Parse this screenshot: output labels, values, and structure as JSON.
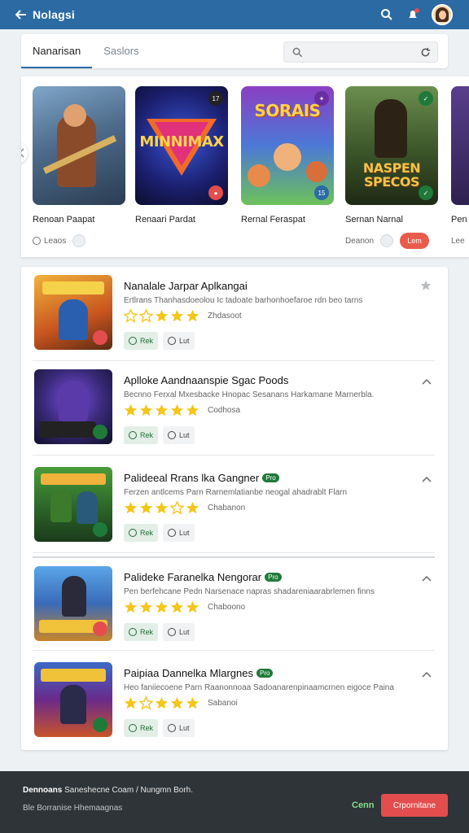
{
  "appbar": {
    "title": "Nolagsi"
  },
  "tabs": {
    "active": "Nanarisan",
    "inactive": "Saslors"
  },
  "carousel": [
    {
      "name": "Renoan Paapat",
      "meta": "Leaos",
      "cta": ""
    },
    {
      "name": "Renaari Pardat",
      "thumb_text": "MINNIMAX",
      "meta": "",
      "cta": ""
    },
    {
      "name": "Rernal Feraspat",
      "thumb_text": "SORAIS",
      "meta": "",
      "cta": ""
    },
    {
      "name": "Sernan Narnal",
      "thumb_text": "NASPEN SPECOS",
      "meta": "Deanon",
      "cta": "Lem"
    },
    {
      "name": "Pen",
      "meta": "Lee",
      "cta": ""
    }
  ],
  "list": [
    {
      "title": "Nanalale Jarpar Aplkangai",
      "tag": "",
      "desc": "Ertlrans Thanhasdoeolou Ic tadoate barhonhoefaroe rdn beo tarns",
      "rating": 5,
      "count": "Zhdasoot",
      "primary": "Rek",
      "secondary": "Lut",
      "chev": "star"
    },
    {
      "title": "Aplloke Aandnaanspie Sgac Poods",
      "tag": "",
      "desc": "Becnno Ferxal  Mxesbacke Hnopac Sesanans Harkamane Marnerbla.",
      "rating": 5,
      "count": "Codhosa",
      "primary": "Rek",
      "secondary": "Lut",
      "chev": "up"
    },
    {
      "title": "Palideeal Rrans lka Gangner",
      "tag": "Pro",
      "desc": "Ferzen antlcems Parn Rarnemlatianbe neogal ahadrablt Flarn",
      "rating": 4,
      "count": "Chabanon",
      "primary": "Rek",
      "secondary": "Lut",
      "chev": "up"
    },
    {
      "title": "Palideke Faranelka Nengorar",
      "tag": "Pro",
      "desc": "Pen berfehcane Pedn Narsenace napras shadareniaarabrlemen finns",
      "rating": 5,
      "count": "Chaboono",
      "primary": "Rek",
      "secondary": "Lut",
      "chev": "up"
    },
    {
      "title": "Paipiaa Dannelka Mlargnes",
      "tag": "Pro",
      "desc": "Heo faniiecoene Parn Raanonnoaa Sadoanarenpinaamcrnen eigoce Paina",
      "rating": 4,
      "count": "Sabanoi",
      "primary": "Rek",
      "secondary": "Lut",
      "chev": "up"
    }
  ],
  "footer": {
    "line1_bold": "Dennoans",
    "line1": "Saneshecne Coam / Nungmn Borh.",
    "line2": "Ble Borranise Hhemaagnas",
    "link": "Cenn",
    "button": "Crpornitane"
  },
  "colors": {
    "appbar": "#2b6aa3",
    "accent_red": "#e34d4d",
    "star": "#f5c518",
    "green": "#1f7a3a"
  }
}
